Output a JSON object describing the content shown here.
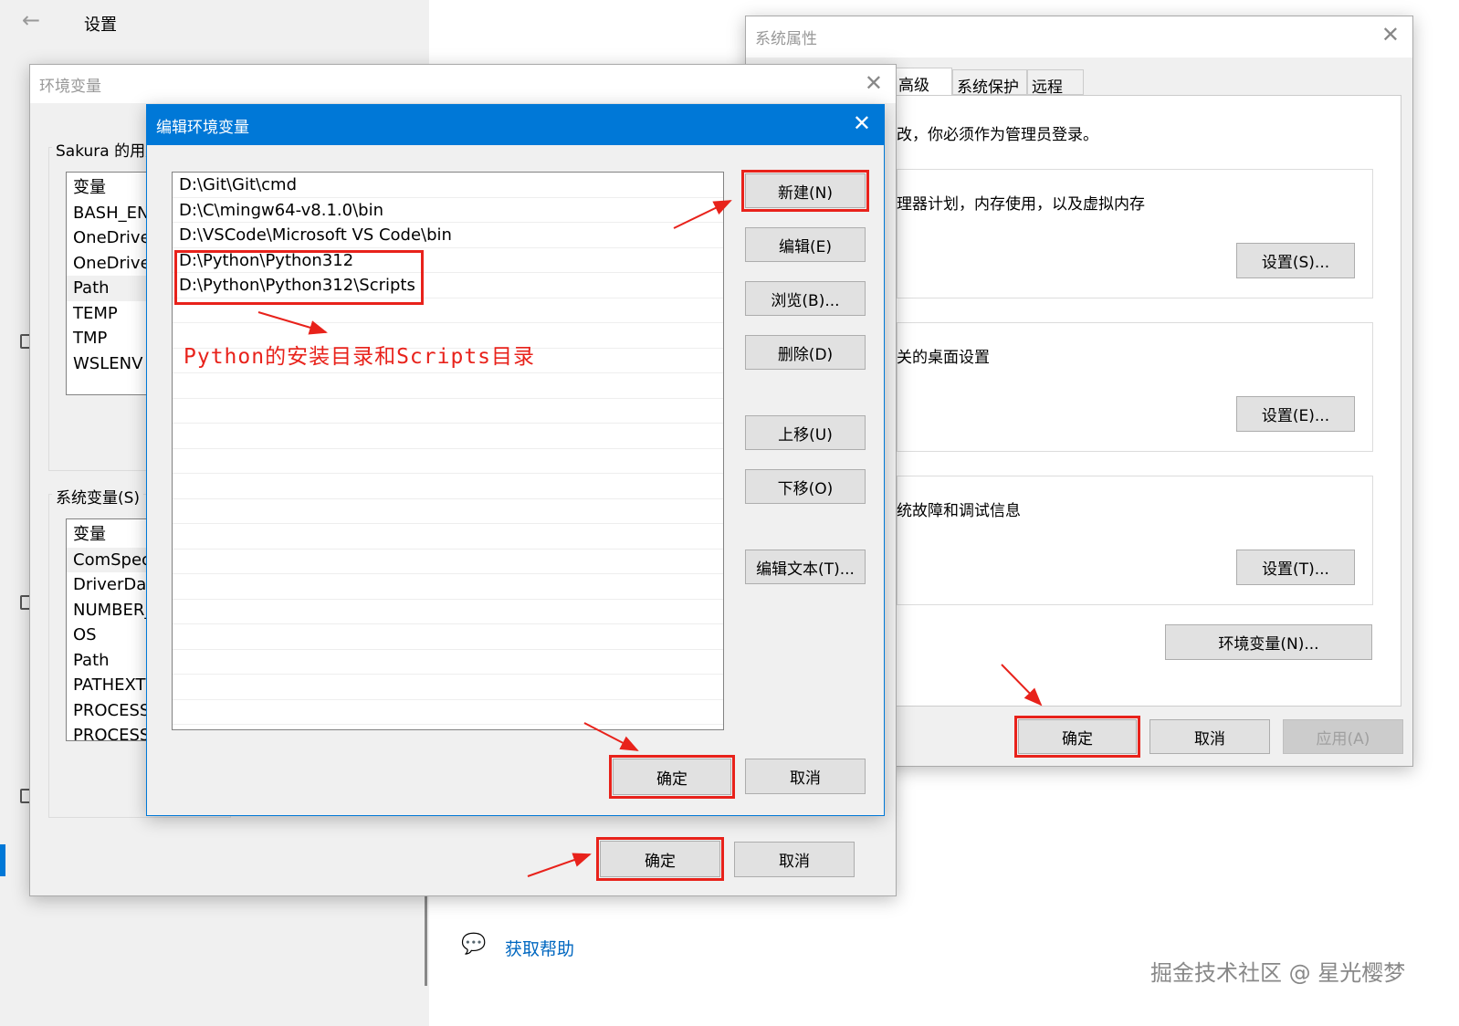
{
  "settings": {
    "title": "设置",
    "help_link": "获取帮助"
  },
  "sysprop": {
    "title": "系统属性",
    "tabs": [
      "高级",
      "系统保护",
      "远程"
    ],
    "admin_note": "改，你必须作为管理员登录。",
    "performance_text": "理器计划，内存使用，以及虚拟内存",
    "performance_btn": "设置(S)...",
    "profile_text": "关的桌面设置",
    "profile_btn": "设置(E)...",
    "startup_text": "统故障和调试信息",
    "startup_btn": "设置(T)...",
    "env_btn": "环境变量(N)...",
    "ok": "确定",
    "cancel": "取消",
    "apply": "应用(A)"
  },
  "envvars": {
    "title": "环境变量",
    "user_group": "Sakura 的用户变量",
    "user_header": "变量",
    "user_vars": [
      "BASH_ENV",
      "OneDrive",
      "OneDrive",
      "Path",
      "TEMP",
      "TMP",
      "WSLENV"
    ],
    "sys_group": "系统变量(S)",
    "sys_header": "变量",
    "sys_vars": [
      "ComSpec",
      "DriverData",
      "NUMBER_",
      "OS",
      "Path",
      "PATHEXT",
      "PROCESS",
      "PROCESS"
    ],
    "ok": "确定",
    "cancel": "取消"
  },
  "edit": {
    "title": "编辑环境变量",
    "entries": [
      "D:\\Git\\Git\\cmd",
      "D:\\C\\mingw64-v8.1.0\\bin",
      "D:\\VSCode\\Microsoft VS Code\\bin",
      "D:\\Python\\Python312",
      "D:\\Python\\Python312\\Scripts"
    ],
    "buttons": {
      "new": "新建(N)",
      "edit": "编辑(E)",
      "browse": "浏览(B)...",
      "delete": "删除(D)",
      "up": "上移(U)",
      "down": "下移(O)",
      "edit_text": "编辑文本(T)..."
    },
    "ok": "确定",
    "cancel": "取消"
  },
  "annotation": "Python的安装目录和Scripts目录",
  "watermark": "掘金技术社区 @ 星光樱梦",
  "colors": {
    "accent": "#0078d7",
    "annotation": "#e8221b"
  }
}
